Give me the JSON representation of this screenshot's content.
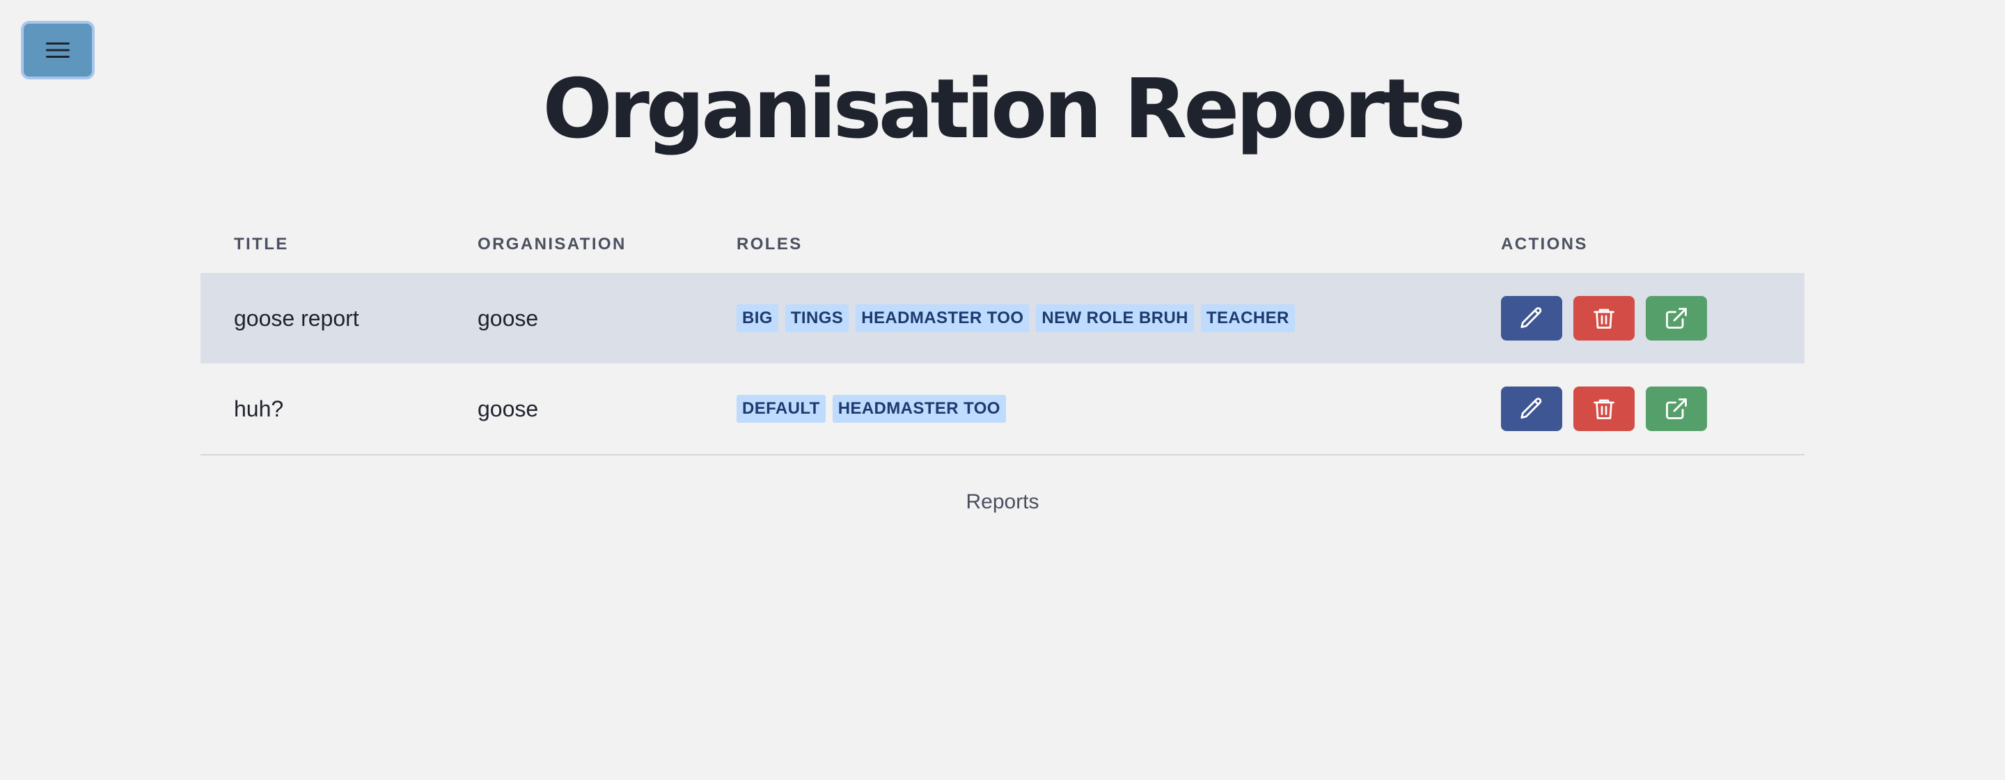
{
  "page": {
    "title": "Organisation Reports",
    "footer": "Reports"
  },
  "menu_button": {
    "icon": "hamburger-menu-icon"
  },
  "table": {
    "headers": {
      "title": "TITLE",
      "organisation": "ORGANISATION",
      "roles": "ROLES",
      "actions": "ACTIONS"
    },
    "rows": [
      {
        "title": "goose report",
        "organisation": "goose",
        "roles": [
          "BIG",
          "TINGS",
          "HEADMASTER TOO",
          "NEW ROLE BRUH",
          "TEACHER"
        ],
        "highlighted": true
      },
      {
        "title": "huh?",
        "organisation": "goose",
        "roles": [
          "DEFAULT",
          "HEADMASTER TOO"
        ],
        "highlighted": false
      }
    ]
  },
  "actions": {
    "edit": {
      "icon": "pencil-icon",
      "color": "#3e5693"
    },
    "delete": {
      "icon": "trash-icon",
      "color": "#d34c45"
    },
    "open": {
      "icon": "external-link-icon",
      "color": "#55a06a"
    }
  },
  "colors": {
    "background": "#f2f2f2",
    "highlight_row": "#dbdfe8",
    "badge_bg": "#bfdbfe",
    "badge_text": "#1e3a6e",
    "menu_button": "#5f96bd"
  }
}
